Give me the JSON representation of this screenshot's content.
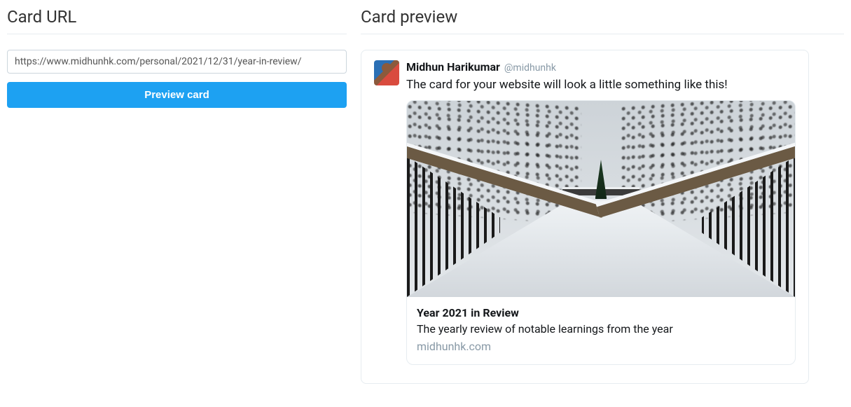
{
  "left": {
    "title": "Card URL",
    "url_value": "https://www.midhunhk.com/personal/2021/12/31/year-in-review/",
    "button_label": "Preview card"
  },
  "right": {
    "title": "Card preview",
    "tweet": {
      "author_name": "Midhun Harikumar",
      "author_handle": "@midhunhk",
      "text": "The card for your website will look a little something like this!"
    },
    "card": {
      "title": "Year 2021 in Review",
      "description": "The yearly review of notable learnings from the year",
      "domain": "midhunhk.com"
    }
  }
}
